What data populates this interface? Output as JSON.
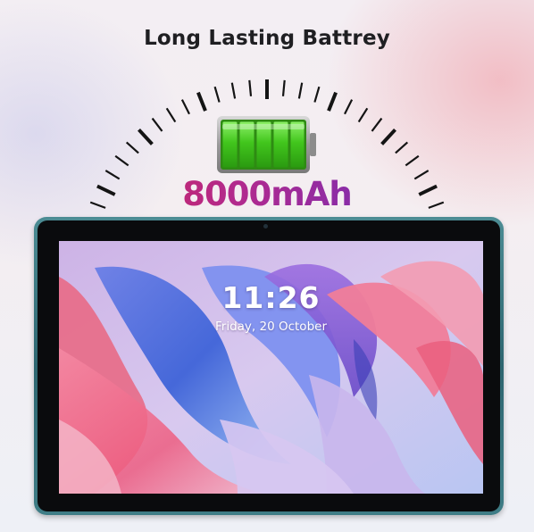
{
  "headline": "Long Lasting Battrey",
  "capacity": "8000mAh",
  "battery": {
    "level": 1.0,
    "fill_color": "#3ec21e",
    "icon": "battery-full-icon"
  },
  "lockscreen": {
    "time": "11:26",
    "date": "Friday, 20 October"
  },
  "colors": {
    "capacity_start": "#e0233f",
    "capacity_end": "#4a2fd0",
    "frame": "#3f7d86"
  }
}
